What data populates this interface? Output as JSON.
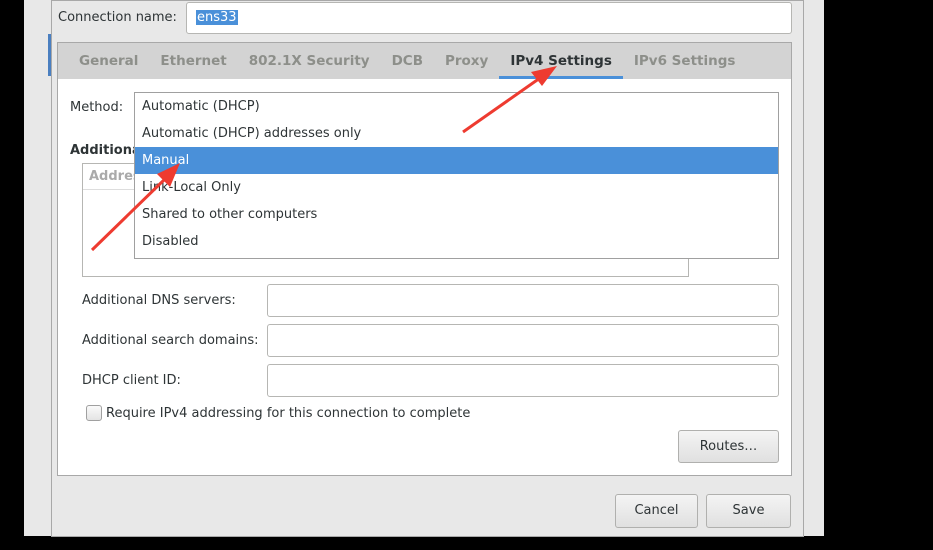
{
  "connection_name_label": "Connection name:",
  "connection_name_value": "ens33",
  "tabs": [
    "General",
    "Ethernet",
    "802.1X Security",
    "DCB",
    "Proxy",
    "IPv4 Settings",
    "IPv6 Settings"
  ],
  "active_tab": "IPv4 Settings",
  "method_label": "Method:",
  "method_options": [
    "Automatic (DHCP)",
    "Automatic (DHCP) addresses only",
    "Manual",
    "Link-Local Only",
    "Shared to other computers",
    "Disabled"
  ],
  "method_highlighted": "Manual",
  "addresses_heading": "Additional static addresses",
  "addresses_column": "Address",
  "dns_label": "Additional DNS servers:",
  "search_label": "Additional search domains:",
  "dhcp_label": "DHCP client ID:",
  "require_label": "Require IPv4 addressing for this connection to complete",
  "require_checked": false,
  "routes_button": "Routes…",
  "cancel_button": "Cancel",
  "save_button": "Save",
  "colors": {
    "accent": "#4a90d9",
    "annotation_arrow": "#ee3b30"
  }
}
